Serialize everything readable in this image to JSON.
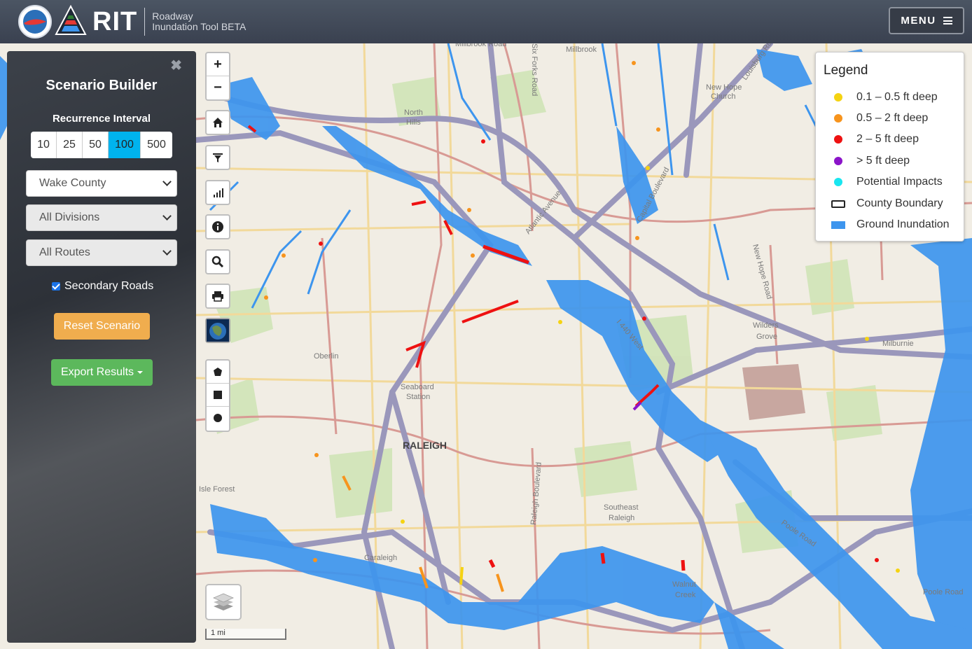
{
  "header": {
    "app_abbrev": "RIT",
    "subtitle_line1": "Roadway",
    "subtitle_line2": "Inundation Tool BETA",
    "menu_label": "MENU",
    "menu_icon": "hamburger-icon"
  },
  "panel": {
    "close_glyph": "✖",
    "title": "Scenario Builder",
    "recurrence_label": "Recurrence Interval",
    "recurrence_options": [
      "10",
      "25",
      "50",
      "100",
      "500"
    ],
    "recurrence_selected": "100",
    "county_select": "Wake County",
    "division_select": "All Divisions",
    "route_select": "All Routes",
    "secondary_roads_label": "Secondary Roads",
    "secondary_roads_checked": true,
    "reset_label": "Reset Scenario",
    "export_label": "Export Results"
  },
  "map_controls": {
    "zoom_in": "+",
    "zoom_out": "−",
    "scale_label": "1 mi",
    "tools": [
      "home-icon",
      "filter-icon",
      "chart-icon",
      "info-icon",
      "search-icon",
      "print-icon",
      "basemap-thumbnail",
      "polygon-draw-icon",
      "rectangle-draw-icon",
      "circle-draw-icon",
      "layers-icon"
    ]
  },
  "legend": {
    "title": "Legend",
    "items": [
      {
        "label": "0.1 – 0.5 ft deep",
        "color": "#f5d312",
        "shape": "dot"
      },
      {
        "label": "0.5 – 2 ft deep",
        "color": "#f7941d",
        "shape": "dot"
      },
      {
        "label": "2 – 5 ft deep",
        "color": "#ee1111",
        "shape": "dot"
      },
      {
        "label": "> 5 ft deep",
        "color": "#8b14c9",
        "shape": "dot"
      },
      {
        "label": "Potential Impacts",
        "color": "#19e6f0",
        "shape": "dot"
      },
      {
        "label": "County Boundary",
        "color": "#222222",
        "shape": "box"
      },
      {
        "label": "Ground Inundation",
        "color": "#3d95ee",
        "shape": "fill"
      }
    ]
  },
  "map_labels": {
    "city": "RALEIGH",
    "places": [
      "North Hills",
      "New Hope Church",
      "Oberlin",
      "Seaboard Station",
      "Isle Forest",
      "Caraleigh",
      "Southeast Raleigh",
      "Walnut Creek",
      "Wilders Grove",
      "Milburnie"
    ],
    "roads": [
      "Millbrook",
      "Millbrook Road",
      "Louisburg Road",
      "Capital Boulevard",
      "Atlantic Avenue",
      "New Hope Road",
      "I 440 West",
      "Raleigh Boulevard",
      "Poole Road",
      "Six Forks Road"
    ]
  },
  "colors": {
    "flood": "#3d95ee",
    "road_major": "#9a97bb",
    "road_secondary": "#d89a94",
    "road_minor": "#f2d99a",
    "park": "#cfe3b6",
    "base": "#f1ede4"
  }
}
